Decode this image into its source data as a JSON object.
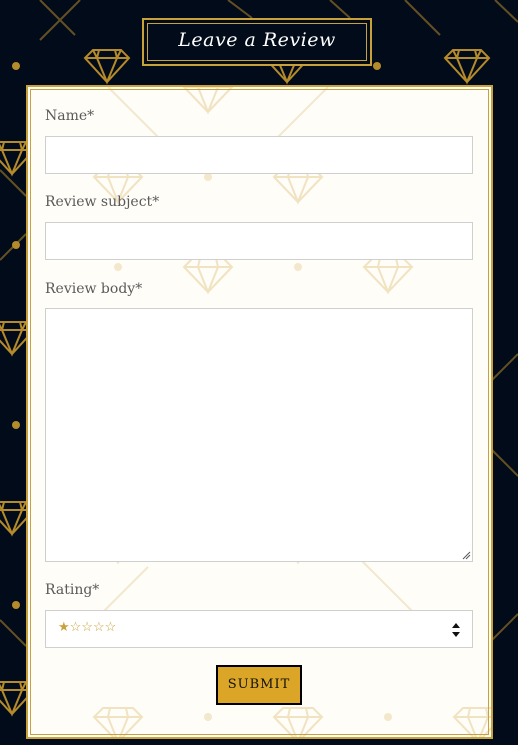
{
  "header": {
    "title": "Leave a Review"
  },
  "form": {
    "name": {
      "label": "Name*",
      "value": ""
    },
    "subject": {
      "label": "Review subject*",
      "value": ""
    },
    "body": {
      "label": "Review body*",
      "value": ""
    },
    "rating": {
      "label": "Rating*",
      "selected": "★☆☆☆☆"
    },
    "submit_label": "SUBMIT"
  },
  "colors": {
    "background": "#020b1a",
    "accent": "#c9a13a",
    "button": "#dba627",
    "card": "#fffdf8"
  },
  "icons": [
    "diamond-icon",
    "select-arrows-icon",
    "resize-handle-icon"
  ]
}
